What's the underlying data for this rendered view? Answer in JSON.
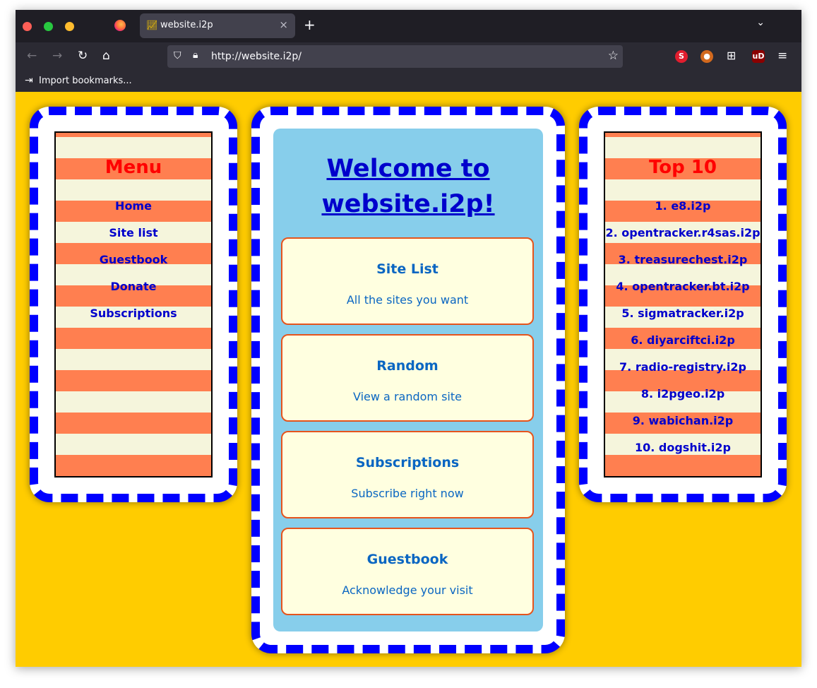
{
  "browser": {
    "tab_title": "website.i2p",
    "tab_close": "×",
    "new_tab": "+",
    "tab_list": "⌄",
    "url": "http://website.i2p/",
    "import_bookmarks": "Import bookmarks...",
    "icons": {
      "back": "←",
      "forward": "→",
      "reload": "↻",
      "home": "⌂",
      "shield": "⛉",
      "lock": "🔒︎",
      "star": "☆",
      "ext_puzzle": "⊞",
      "menu": "≡",
      "import": "⇥"
    },
    "colors": {
      "titlebar": "#1f1e25",
      "toolbar": "#2b2a33",
      "urlbar": "#42414d"
    }
  },
  "page": {
    "background": "#ffcc00",
    "menu": {
      "title": "Menu",
      "items": [
        "Home",
        "Site list",
        "Guestbook",
        "Donate",
        "Subscriptions"
      ]
    },
    "welcome": {
      "line1": "Welcome to",
      "line2": "website.i2p!"
    },
    "cards": [
      {
        "title": "Site List",
        "desc": "All the sites you want"
      },
      {
        "title": "Random",
        "desc": "View a random site"
      },
      {
        "title": "Subscriptions",
        "desc": "Subscribe right now"
      },
      {
        "title": "Guestbook",
        "desc": "Acknowledge your visit"
      }
    ],
    "top10": {
      "title": "Top 10",
      "items": [
        "1. e8.i2p",
        "2. opentracker.r4sas.i2p",
        "3. treasurechest.i2p",
        "4. opentracker.bt.i2p",
        "5. sigmatracker.i2p",
        "6. diyarciftci.i2p",
        "7. radio-registry.i2p",
        "8. i2pgeo.i2p",
        "9. wabichan.i2p",
        "10. dogshit.i2p"
      ]
    }
  }
}
